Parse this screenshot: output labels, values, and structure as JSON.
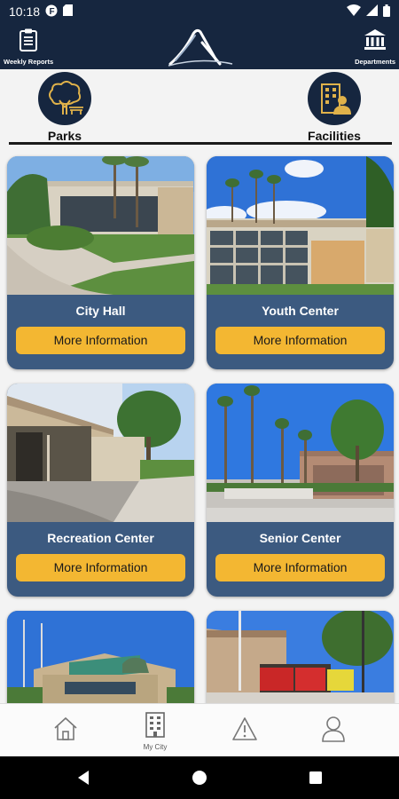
{
  "status": {
    "time": "10:18"
  },
  "header": {
    "left_label": "Weekly Reports",
    "right_label": "Departments"
  },
  "categories": [
    {
      "label": "Parks",
      "icon": "tree-icon"
    },
    {
      "label": "Facilities",
      "icon": "building-person-icon"
    }
  ],
  "cards": [
    {
      "title": "City Hall",
      "button": "More Information"
    },
    {
      "title": "Youth Center",
      "button": "More Information"
    },
    {
      "title": "Recreation Center",
      "button": "More Information"
    },
    {
      "title": "Senior Center",
      "button": "More Information"
    },
    {
      "title": "",
      "button": ""
    },
    {
      "title": "",
      "button": ""
    }
  ],
  "nav": [
    {
      "label": "",
      "icon": "home-icon"
    },
    {
      "label": "My City",
      "icon": "city-building-icon"
    },
    {
      "label": "",
      "icon": "warning-icon"
    },
    {
      "label": "",
      "icon": "profile-icon"
    }
  ],
  "colors": {
    "header_bg": "#16263f",
    "card_bg": "#3c5a80",
    "button_bg": "#f3b732"
  }
}
